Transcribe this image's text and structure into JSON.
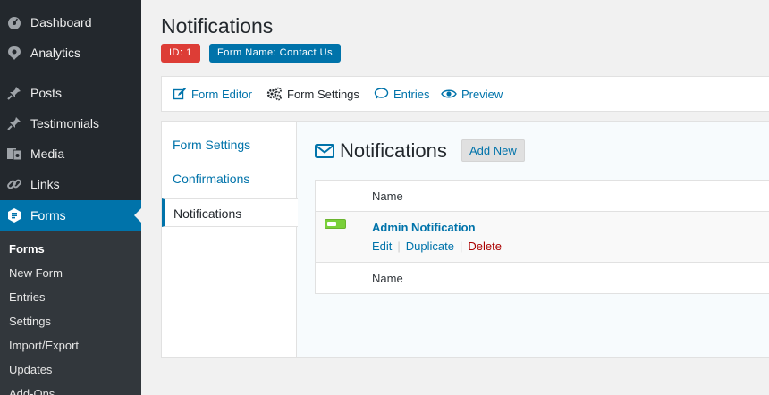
{
  "sidebar": {
    "items": [
      {
        "label": "Dashboard",
        "icon": "dashboard-icon"
      },
      {
        "label": "Analytics",
        "icon": "analytics-icon"
      },
      {
        "label": "Posts",
        "icon": "pin-icon"
      },
      {
        "label": "Testimonials",
        "icon": "pin-icon"
      },
      {
        "label": "Media",
        "icon": "media-icon"
      },
      {
        "label": "Links",
        "icon": "link-icon"
      },
      {
        "label": "Forms",
        "icon": "forms-icon"
      }
    ],
    "submenu": [
      "Forms",
      "New Form",
      "Entries",
      "Settings",
      "Import/Export",
      "Updates",
      "Add-Ons"
    ]
  },
  "header": {
    "title": "Notifications",
    "id_badge": "ID: 1",
    "form_badge": "Form Name: Contact Us"
  },
  "toolbar": {
    "form_editor": "Form Editor",
    "form_settings": "Form Settings",
    "entries": "Entries",
    "preview": "Preview"
  },
  "subnav": {
    "form_settings": "Form Settings",
    "confirmations": "Confirmations",
    "notifications": "Notifications"
  },
  "content": {
    "title": "Notifications",
    "add_new": "Add New",
    "column_header": "Name",
    "column_footer": "Name",
    "rows": [
      {
        "name": "Admin Notification",
        "edit": "Edit",
        "duplicate": "Duplicate",
        "delete": "Delete",
        "separator": "|"
      }
    ]
  },
  "colors": {
    "sidebar_bg": "#23282d",
    "active_blue": "#0073aa",
    "id_badge": "#dd3d36",
    "toggle_on": "#7ad03a",
    "delete_red": "#aa0000"
  }
}
